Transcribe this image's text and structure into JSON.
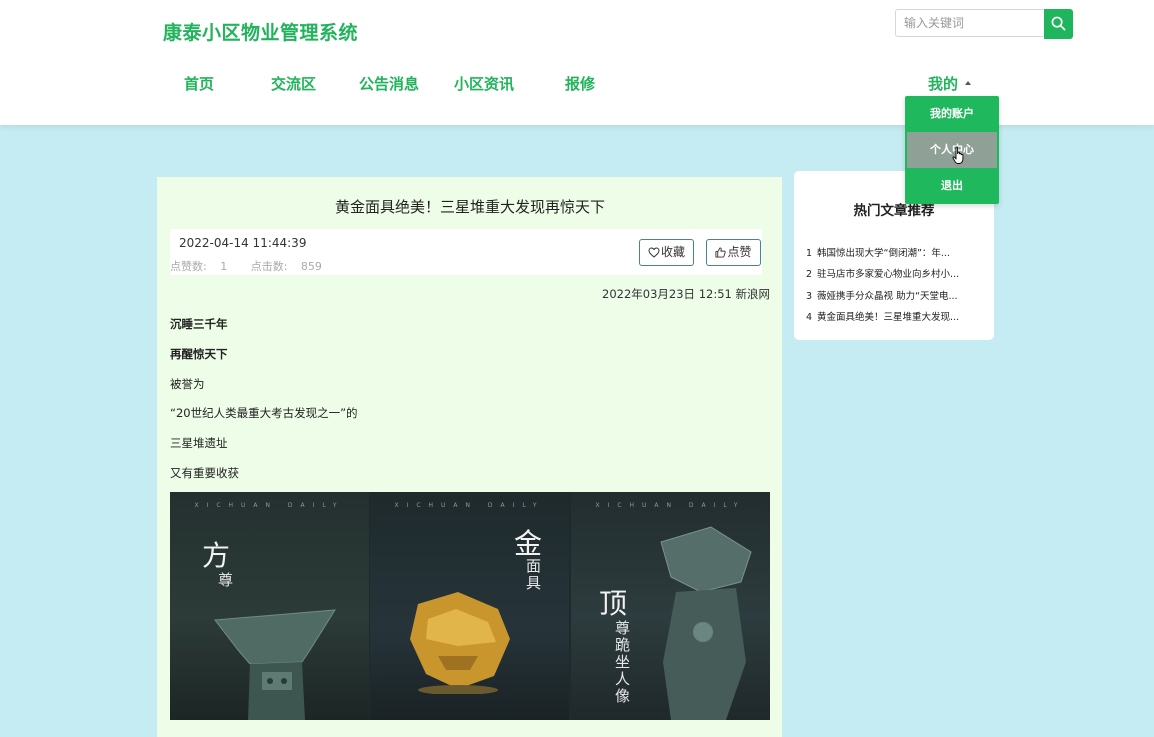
{
  "site": {
    "title": "康泰小区物业管理系统"
  },
  "search": {
    "placeholder": "输入关键词"
  },
  "nav": {
    "items": [
      "首页",
      "交流区",
      "公告消息",
      "小区资讯",
      "报修"
    ],
    "account": "我的"
  },
  "dropdown": {
    "items": [
      "我的账户",
      "个人中心",
      "退出"
    ],
    "active": "个人中心"
  },
  "article": {
    "title": "黄金面具绝美！三星堆重大发现再惊天下",
    "datetime": "2022-04-14 11:44:39",
    "likes_label": "点赞数: ",
    "likes": "1",
    "clicks_label": "点击数: ",
    "clicks": "859",
    "favorite_label": "收藏",
    "like_label": "点赞",
    "source": "2022年03月23日 12:51 新浪网",
    "paragraphs": [
      {
        "text": "沉睡三千年",
        "bold": true
      },
      {
        "text": "再醒惊天下",
        "bold": true
      },
      {
        "text": "被誉为",
        "bold": false
      },
      {
        "text": "“20世纪人类最重大考古发现之一”的",
        "bold": false
      },
      {
        "text": "三星堆遗址",
        "bold": false
      },
      {
        "text": "又有重要收获",
        "bold": false
      }
    ],
    "image": {
      "header_text": "XICHUAN DAILY",
      "panels": [
        {
          "big": "方",
          "small": "尊"
        },
        {
          "big": "金",
          "small": "面具"
        },
        {
          "big": "顶",
          "small": "尊跪坐人像"
        }
      ]
    }
  },
  "sidebar": {
    "title": "热门文章推荐",
    "items": [
      {
        "num": "1",
        "text": "韩国惊出现大学“倒闭潮”：年..."
      },
      {
        "num": "2",
        "text": "驻马店市多家爱心物业向乡村小..."
      },
      {
        "num": "3",
        "text": "薇娅携手分众晶视 助力“天堂电..."
      },
      {
        "num": "4",
        "text": "黄金面具绝美！三星堆重大发现..."
      }
    ]
  },
  "colors": {
    "brand_green": "#22b35c",
    "page_bg": "#c4ecf2",
    "card_bg": "#edfde8"
  }
}
